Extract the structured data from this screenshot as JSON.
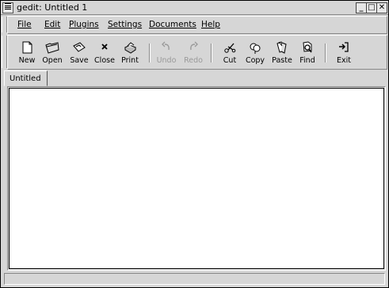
{
  "window": {
    "title": "gedit: Untitled 1"
  },
  "title_buttons": {
    "minimize": "_",
    "maximize": "□",
    "close": "✕"
  },
  "menubar": {
    "items": [
      {
        "label": "File"
      },
      {
        "label": "Edit"
      },
      {
        "label": "Plugins"
      },
      {
        "label": "Settings"
      },
      {
        "label": "Documents"
      },
      {
        "label": "Help"
      }
    ]
  },
  "toolbar": {
    "items": [
      {
        "label": "New",
        "icon": "new-document-icon",
        "enabled": true
      },
      {
        "label": "Open",
        "icon": "open-folder-icon",
        "enabled": true
      },
      {
        "label": "Save",
        "icon": "save-disk-icon",
        "enabled": true
      },
      {
        "label": "Close",
        "icon": "close-x-icon",
        "enabled": true
      },
      {
        "label": "Print",
        "icon": "printer-icon",
        "enabled": true
      },
      {
        "label": "Undo",
        "icon": "undo-arrow-icon",
        "enabled": false
      },
      {
        "label": "Redo",
        "icon": "redo-arrow-icon",
        "enabled": false
      },
      {
        "label": "Cut",
        "icon": "scissors-icon",
        "enabled": true
      },
      {
        "label": "Copy",
        "icon": "copy-icon",
        "enabled": true
      },
      {
        "label": "Paste",
        "icon": "paste-icon",
        "enabled": true
      },
      {
        "label": "Find",
        "icon": "find-icon",
        "enabled": true
      },
      {
        "label": "Exit",
        "icon": "exit-icon",
        "enabled": true
      }
    ]
  },
  "tabs": [
    {
      "label": "Untitled"
    }
  ],
  "editor": {
    "content": ""
  },
  "statusbar": {
    "text": ""
  }
}
